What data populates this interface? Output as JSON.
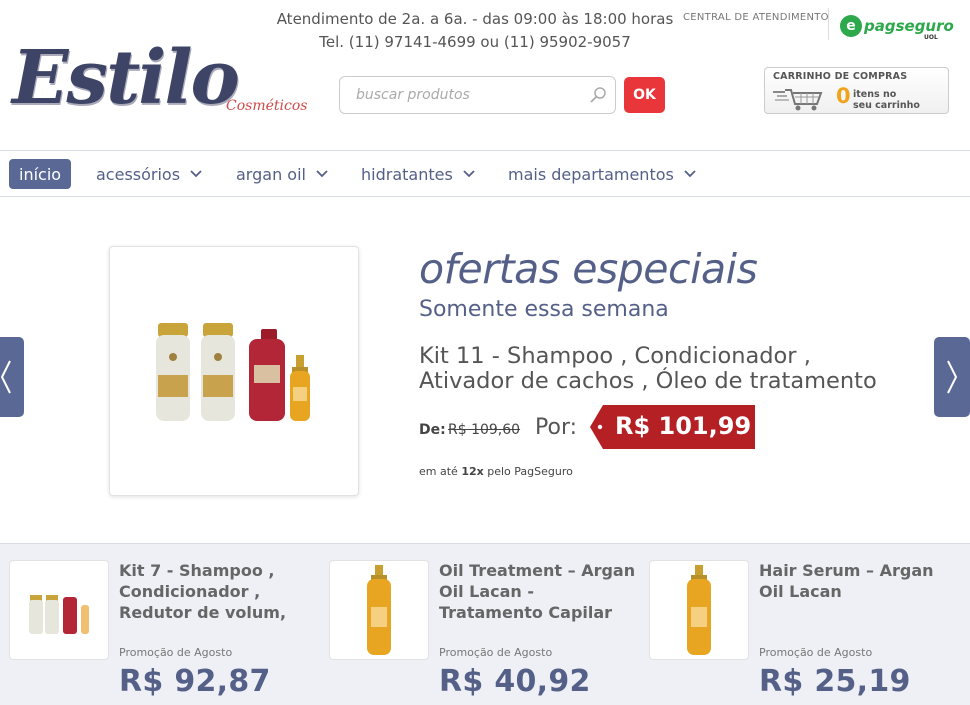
{
  "header": {
    "logo_text": "Estilo",
    "logo_subtitle": "Cosméticos",
    "hours_line1": "Atendimento de 2a. a 6a. - das 09:00 às 18:00 horas",
    "hours_line2": "Tel. (11) 97141-4699 ou (11) 95902-9057",
    "central_label": "CENTRAL DE ATENDIMENTO",
    "pagseguro_label": "pagseguro",
    "pagseguro_uol": "UOL",
    "search_placeholder": "buscar produtos",
    "search_button": "OK",
    "cart_title": "CARRINHO DE COMPRAS",
    "cart_count": "0",
    "cart_items_line1": "itens no",
    "cart_items_line2": "seu carrinho"
  },
  "nav": {
    "items": [
      {
        "label": "início",
        "active": true
      },
      {
        "label": "acessórios",
        "active": false
      },
      {
        "label": "argan oil",
        "active": false
      },
      {
        "label": "hidratantes",
        "active": false
      },
      {
        "label": "mais departamentos",
        "active": false
      }
    ]
  },
  "banner": {
    "title": "ofertas especiais",
    "subtitle": "Somente essa semana",
    "product_line1": "Kit 11 - Shampoo , Condicionador ,",
    "product_line2": "Ativador de cachos , Óleo de tratamento",
    "de_label": "De:",
    "old_price": "R$ 109,60",
    "por_label": "Por:",
    "price": "R$ 101,99",
    "installments_prefix": "em até",
    "installments_count": "12x",
    "installments_suffix": "pelo PagSeguro"
  },
  "products": [
    {
      "name": "Kit 7 - Shampoo , Condicionador , Redutor de volum,",
      "promo": "Promoção de Agosto",
      "price": "R$ 92,87"
    },
    {
      "name": "Oil Treatment – Argan Oil Lacan - Tratamento Capilar",
      "promo": "Promoção de Agosto",
      "price": "R$ 40,92"
    },
    {
      "name": "Hair Serum – Argan Oil Lacan",
      "promo": "Promoção de Agosto",
      "price": "R$ 25,19"
    }
  ],
  "colors": {
    "brand": "#556088",
    "nav_active": "#5a6896",
    "ok_button": "#e8363a",
    "price_tag": "#b52025",
    "cart_count": "#f0a41d",
    "pagseguro": "#2da84a"
  }
}
